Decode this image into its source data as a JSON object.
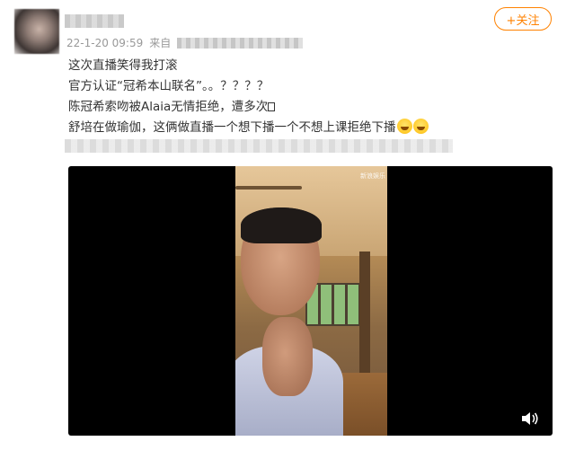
{
  "post": {
    "timestamp": "22-1-20 09:59",
    "source_prefix": "来自",
    "follow_label": "+关注",
    "lines": [
      "这次直播笑得我打滚",
      "官方认证“冠希本山联名”。。？？？？",
      "陈冠希索吻被Alaia无情拒绝，遭多次",
      "舒培在做瑜伽，这俩做直播一个想下播一个不想上课拒绝下播"
    ],
    "emoji": "laughing-tears-icon"
  },
  "video": {
    "watermark": "新浪娱乐",
    "volume_icon": "volume-icon"
  },
  "colors": {
    "accent": "#ff8200",
    "text": "#333333",
    "meta": "#999999"
  }
}
